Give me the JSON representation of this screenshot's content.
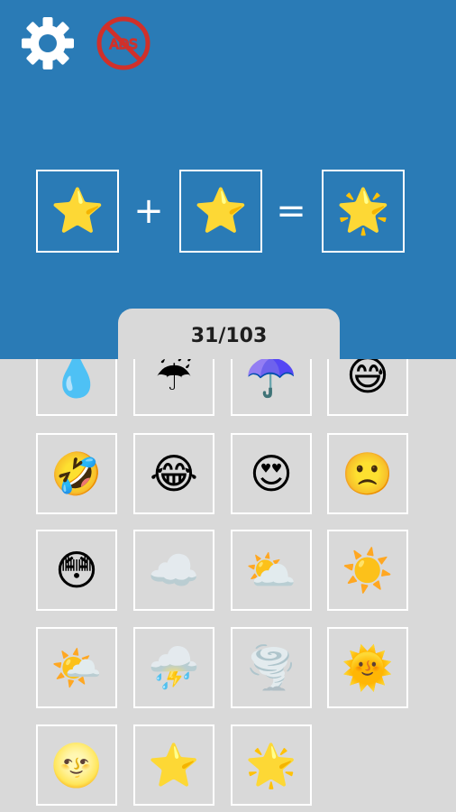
{
  "toolbar": {
    "settings_icon": "gear-icon",
    "no_ads_icon": "no-ads-icon",
    "no_ads_text": "ADS"
  },
  "colors": {
    "header_bg": "#2a7bb6",
    "content_bg": "#d9d9d9",
    "tile_border": "#ffffff",
    "no_ads_red": "#d0302a"
  },
  "recipe": {
    "input_a": "⭐",
    "operator_plus": "+",
    "input_b": "⭐",
    "operator_equals": "=",
    "result": "🌟"
  },
  "progress": {
    "label": "31/103",
    "discovered": 31,
    "total": 103
  },
  "elements": [
    "💧",
    "☔",
    "☂️",
    "😅",
    "🤣",
    "😂",
    "😍",
    "🙁",
    "😳",
    "☁️",
    "⛅",
    "☀️",
    "🌤️",
    "⛈️",
    "🌪️",
    "🌞",
    "🌝",
    "⭐",
    "🌟"
  ]
}
